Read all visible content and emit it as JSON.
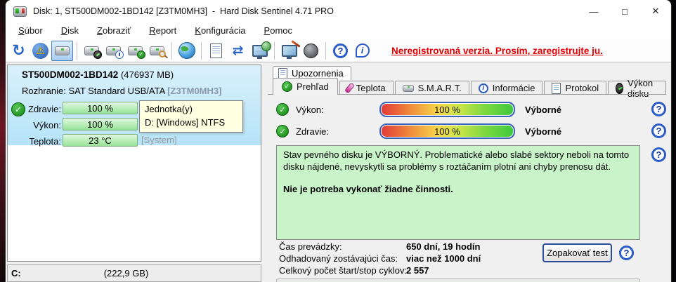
{
  "window": {
    "title": "Disk: 1, ST500DM002-1BD142 [Z3TM0MH3]  -  Hard Disk Sentinel 4.71 PRO",
    "controls": {
      "minimize": "—",
      "maximize": "□",
      "close": "✕"
    }
  },
  "menu": {
    "items": [
      {
        "u": "S",
        "rest": "úbor"
      },
      {
        "u": "D",
        "rest": "isk"
      },
      {
        "u": "Z",
        "rest": "obraziť"
      },
      {
        "u": "R",
        "rest": "eport"
      },
      {
        "u": "K",
        "rest": "onfigurácia"
      },
      {
        "u": "P",
        "rest": "omoc"
      }
    ]
  },
  "toolbar": {
    "notice": "Neregistrovaná verzia. Prosím, zaregistrujte ju.",
    "icon_names": [
      "refresh-icon",
      "disk-alert-icon",
      "disk-view-icon",
      "disk-performance-icon",
      "disk-schedule-icon",
      "disk-health-icon",
      "disk-search-icon",
      "network-disks-icon",
      "report-icon",
      "sync-icon",
      "remote-computer-icon",
      "hardware-test-icon",
      "sound-icon",
      "help-icon",
      "info-icon"
    ]
  },
  "disk": {
    "model": "ST500DM002-1BD142",
    "capacity": "(476937 MB)",
    "interface_label": "Rozhranie:",
    "interface_value": "SAT Standard USB/ATA",
    "serial": "[Z3TM0MH3]",
    "rows": [
      {
        "label": "Zdravie:",
        "value": "100 %"
      },
      {
        "label": "Výkon:",
        "value": "100 %"
      },
      {
        "label": "Teplota:",
        "value": "23 °C"
      }
    ],
    "system_tag": "[System]",
    "tooltip": {
      "title": "Jednotka(y)",
      "line": "D: [Windows] NTFS"
    },
    "partition": {
      "drive": "C:",
      "size": "(222,9 GB)"
    }
  },
  "tabs": {
    "alerts": "Upozornenia",
    "active": "Prehľad",
    "items": [
      {
        "label": "Prehľad"
      },
      {
        "label": "Teplota"
      },
      {
        "label": "S.M.A.R.T."
      },
      {
        "label": "Informácie"
      },
      {
        "label": "Protokol"
      },
      {
        "label": "Výkon disku"
      }
    ]
  },
  "overview": {
    "performance": {
      "label": "Výkon:",
      "value": "100 %",
      "rating": "Výborné"
    },
    "health": {
      "label": "Zdravie:",
      "value": "100 %",
      "rating": "Výborné"
    },
    "status": {
      "text": "Stav pevného disku je VÝBORNÝ. Problematické alebo slabé sektory neboli na tomto disku nájdené, nevyskytli sa problémy s roztáčaním plotní ani chyby prenosu dát.",
      "action": "Nie je potreba vykonať žiadne činnosti."
    },
    "stats": [
      {
        "label": "Čas prevádzky:",
        "value": "650 dní, 19 hodín"
      },
      {
        "label": "Odhadovaný zostávajúci čas:",
        "value": "viac než 1000 dní"
      },
      {
        "label": "Celkový počet štart/stop cyklov:",
        "value": "2 557"
      }
    ],
    "retest_button": "Zopakovať test"
  }
}
